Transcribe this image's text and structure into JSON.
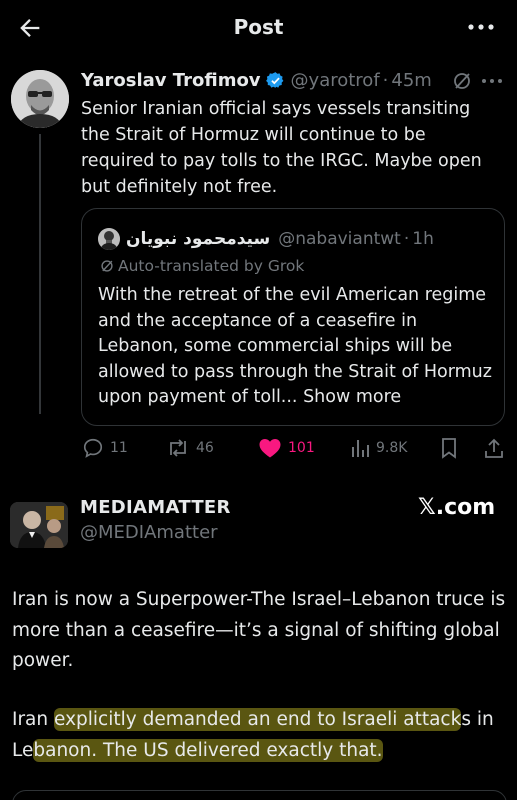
{
  "topbar": {
    "title": "Post",
    "back_icon": "arrow-left-icon",
    "more_icon": "ellipsis-icon"
  },
  "tweet": {
    "author_name": "Yaroslav Trofimov",
    "handle": "@yarotrof",
    "separator": "·",
    "time": "45m",
    "verified_color": "#1d9bf0",
    "text": "Senior Iranian official says vessels transiting the Strait of Hormuz will continue to be required to pay tolls to the IRGC. Maybe open but definitely not free.",
    "quote": {
      "author_name": "سیدمحمود نبویان",
      "handle": "@nabaviantwt",
      "separator": "·",
      "time": "1h",
      "translated_label": "Auto-translated by Grok",
      "text": "With the retreat of the evil American regime and the acceptance of a ceasefire in Lebanon, some commercial ships will be allowed to pass through the Strait of Hormuz upon payment of toll...",
      "show_more": "Show more"
    },
    "actions": {
      "replies": "11",
      "reposts": "46",
      "likes": "101",
      "views": "9.8K",
      "like_color": "#f91880"
    }
  },
  "card": {
    "name": "MEDIAMATTER",
    "handle": "@MEDIAmatter",
    "brand": "𝕏.com",
    "para1": "Iran is now a Superpower-The Israel–Lebanon truce is more than a ceasefire—it’s a signal of shifting global power.",
    "para2_a": "Iran ",
    "para2_h1": "explicitly demanded an end to Israeli attack",
    "para2_b": "s in Le",
    "para2_h2": "banon. The US delivered exactly that.",
    "highlight_color": "#d6cc28"
  }
}
